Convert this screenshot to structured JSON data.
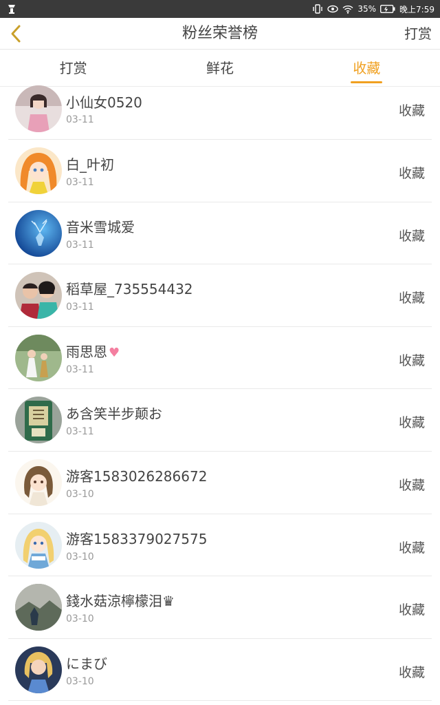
{
  "status_bar": {
    "battery": "35%",
    "time": "晚上7:59"
  },
  "header": {
    "title": "粉丝荣誉榜",
    "action_label": "打赏"
  },
  "tabs": [
    {
      "label": "打赏",
      "active": false
    },
    {
      "label": "鲜花",
      "active": false
    },
    {
      "label": "收藏",
      "active": true
    }
  ],
  "fans": [
    {
      "name": "小仙女0520",
      "date": "03-11",
      "action": "收藏"
    },
    {
      "name": "白_叶初",
      "date": "03-11",
      "action": "收藏"
    },
    {
      "name": "音米雪城爱",
      "date": "03-11",
      "action": "收藏"
    },
    {
      "name": "稻草屋_735554432",
      "date": "03-11",
      "action": "收藏"
    },
    {
      "name": "雨思恩",
      "date": "03-11",
      "action": "收藏"
    },
    {
      "name": "あ含笑半步颠お",
      "date": "03-11",
      "action": "收藏"
    },
    {
      "name": "游客1583026286672",
      "date": "03-10",
      "action": "收藏"
    },
    {
      "name": "游客1583379027575",
      "date": "03-10",
      "action": "收藏"
    },
    {
      "name": "錢水菇涼檸檬泪♛",
      "date": "03-10",
      "action": "收藏"
    },
    {
      "name": "にまび",
      "date": "03-10",
      "action": "收藏"
    }
  ],
  "colors": {
    "accent": "#f0a020",
    "status_bar": "#3a3a3a"
  }
}
